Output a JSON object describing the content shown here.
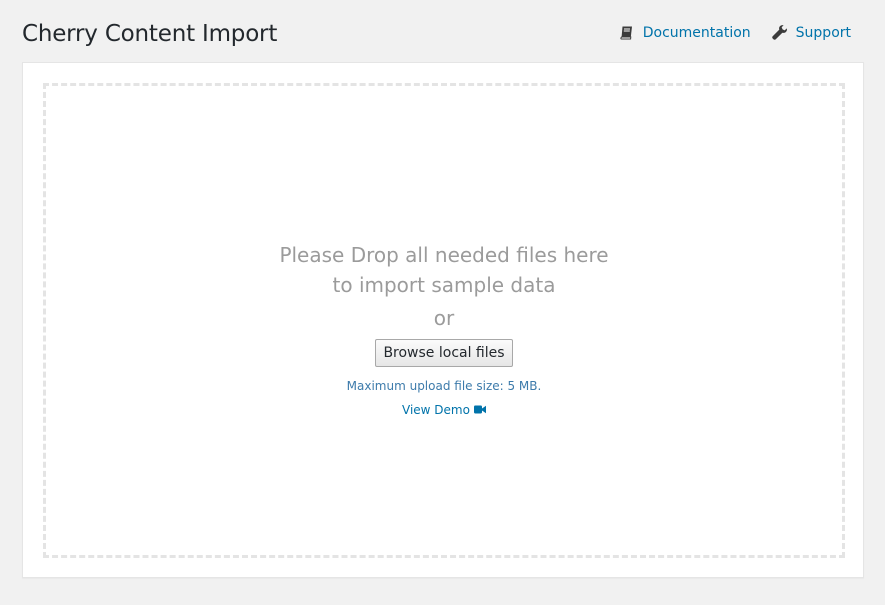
{
  "header": {
    "title": "Cherry Content Import",
    "links": [
      {
        "label": "Documentation",
        "icon": "book-icon"
      },
      {
        "label": "Support",
        "icon": "wrench-icon"
      }
    ]
  },
  "dropzone": {
    "message_line1": "Please Drop all needed files here",
    "message_line2": "to import sample data",
    "or_text": "or",
    "browse_button": "Browse local files",
    "max_upload": "Maximum upload file size: 5 MB.",
    "view_demo": "View Demo",
    "view_demo_icon": "video-camera-icon"
  },
  "colors": {
    "link": "#0073aa",
    "message": "#9b9b9b",
    "background": "#f1f1f1"
  }
}
